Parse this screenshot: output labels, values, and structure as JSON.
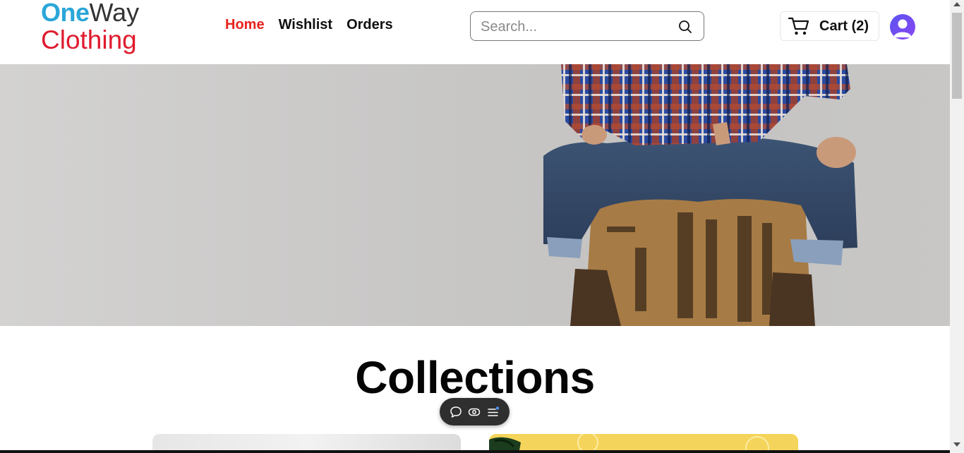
{
  "brand": {
    "part1": "One",
    "part2": "Way",
    "part3": "Clothing",
    "color_primary": "#2aa6d8",
    "color_secondary": "#e01b2e"
  },
  "nav": {
    "items": [
      {
        "label": "Home",
        "active": true
      },
      {
        "label": "Wishlist",
        "active": false
      },
      {
        "label": "Orders",
        "active": false
      }
    ],
    "active_color": "#e8221c"
  },
  "search": {
    "placeholder": "Search...",
    "value": "",
    "icon": "search-icon"
  },
  "cart": {
    "label": "Cart (2)",
    "icon": "cart-icon"
  },
  "profile": {
    "icon": "user-avatar-icon"
  },
  "hero": {
    "image": "man-in-plaid-shirt-sitting-on-crate"
  },
  "collections": {
    "title": "Collections"
  },
  "toolbar": {
    "icons": [
      "comment-icon",
      "eye-icon",
      "menu-list-icon"
    ]
  }
}
